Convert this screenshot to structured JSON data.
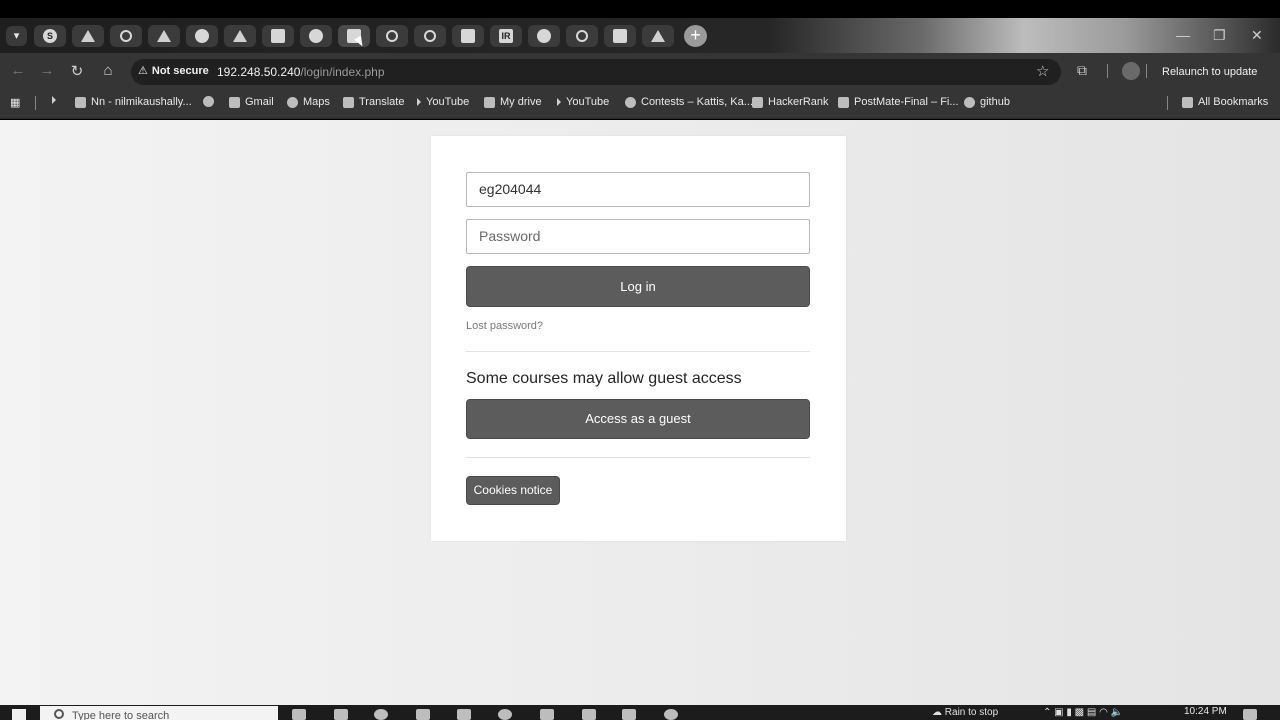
{
  "browser": {
    "tabs": [
      {
        "icon": "s-icon",
        "glyph": "S",
        "active": false
      },
      {
        "icon": "drive-icon",
        "glyph": "",
        "active": false
      },
      {
        "icon": "openai-icon",
        "glyph": "",
        "active": false
      },
      {
        "icon": "arrow-icon",
        "glyph": "",
        "active": false
      },
      {
        "icon": "home-icon",
        "glyph": "",
        "active": false
      },
      {
        "icon": "drive-icon",
        "glyph": "",
        "active": false
      },
      {
        "icon": "plus-box-icon",
        "glyph": "",
        "active": false
      },
      {
        "icon": "github-icon",
        "glyph": "",
        "active": false
      },
      {
        "icon": "moodle-icon",
        "glyph": "",
        "active": true
      },
      {
        "icon": "chatgpt-icon",
        "glyph": "",
        "active": false
      },
      {
        "icon": "infinity-icon",
        "glyph": "",
        "active": false
      },
      {
        "icon": "doc-icon",
        "glyph": "",
        "active": false
      },
      {
        "icon": "ir-icon",
        "glyph": "IR",
        "active": false
      },
      {
        "icon": "circle-g-icon",
        "glyph": "",
        "active": false
      },
      {
        "icon": "infinity-icon",
        "glyph": "",
        "active": false
      },
      {
        "icon": "doc-icon",
        "glyph": "",
        "active": false
      },
      {
        "icon": "drive-icon",
        "glyph": "",
        "active": false
      }
    ],
    "address": {
      "security_label": "Not secure",
      "host": "192.248.50.240",
      "path": "/login/index.php"
    },
    "relaunch_label": "Relaunch to update",
    "bookmarks": [
      {
        "label": "",
        "icon": "apps-icon"
      },
      {
        "label": "Nn - nilmikaushally...",
        "icon": "bookmark-icon"
      },
      {
        "label": "",
        "icon": "globe-icon"
      },
      {
        "label": "Gmail",
        "icon": "gmail-icon"
      },
      {
        "label": "Maps",
        "icon": "maps-icon"
      },
      {
        "label": "Translate",
        "icon": "translate-icon"
      },
      {
        "label": "YouTube",
        "icon": "youtube-icon"
      },
      {
        "label": "My drive",
        "icon": "drive-icon"
      },
      {
        "label": "YouTube",
        "icon": "youtube-icon"
      },
      {
        "label": "Contests – Kattis, Ka...",
        "icon": "kattis-icon"
      },
      {
        "label": "HackerRank",
        "icon": "hackerrank-icon"
      },
      {
        "label": "PostMate-Final – Fi...",
        "icon": "figma-icon"
      },
      {
        "label": "github",
        "icon": "github-icon"
      }
    ],
    "all_bookmarks_label": "All Bookmarks"
  },
  "login": {
    "username_value": "eg204044",
    "password_placeholder": "Password",
    "login_button": "Log in",
    "lost_password": "Lost password?",
    "guest_heading": "Some courses may allow guest access",
    "guest_button": "Access as a guest",
    "cookies_button": "Cookies notice"
  },
  "taskbar": {
    "search_placeholder": "Type here to search",
    "weather_text": "Rain to stop",
    "time": "10:24 PM"
  },
  "colors": {
    "button": "#5c5c5c",
    "card": "#ffffff",
    "page_bg": "#ececec",
    "chrome_toolbar": "#353535"
  }
}
